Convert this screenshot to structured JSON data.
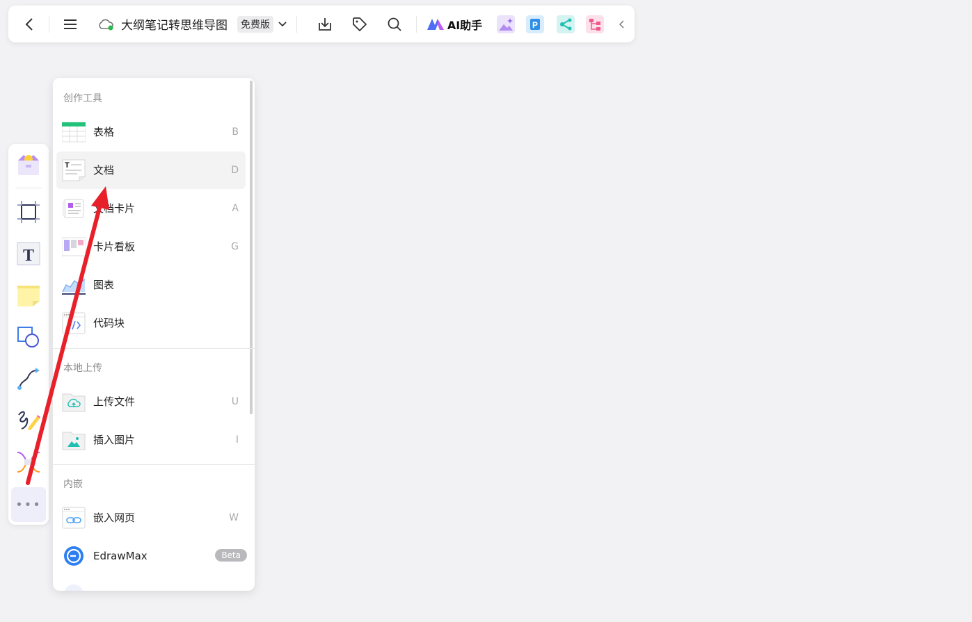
{
  "header": {
    "title": "大纲笔记转思维导图",
    "plan_badge": "免费版",
    "ai_label": "AI助手"
  },
  "menu": {
    "sections": [
      {
        "title": "创作工具",
        "items": [
          {
            "label": "表格",
            "key": "B"
          },
          {
            "label": "文档",
            "key": "D"
          },
          {
            "label": "文档卡片",
            "key": "A"
          },
          {
            "label": "卡片看板",
            "key": "G"
          },
          {
            "label": "图表",
            "key": ""
          },
          {
            "label": "代码块",
            "key": ""
          }
        ]
      },
      {
        "title": "本地上传",
        "items": [
          {
            "label": "上传文件",
            "key": "U"
          },
          {
            "label": "插入图片",
            "key": "I"
          }
        ]
      },
      {
        "title": "内嵌",
        "items": [
          {
            "label": "嵌入网页",
            "key": "W"
          },
          {
            "label": "EdrawMax",
            "badge": "Beta"
          }
        ]
      }
    ]
  },
  "leftbar": {
    "more_label": "•••"
  },
  "colors": {
    "accent": "#6f6cf0",
    "arrow": "#e8202a",
    "hover": "#f3f3f4"
  }
}
